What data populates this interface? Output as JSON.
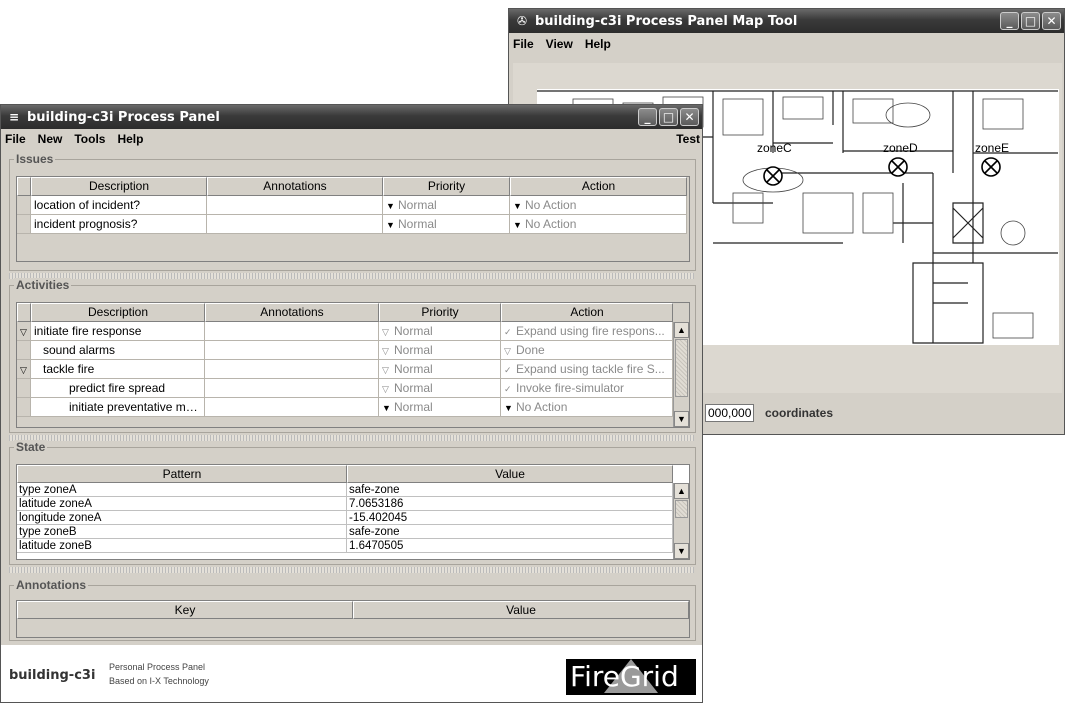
{
  "map_window": {
    "title": "building-c3i Process Panel Map Tool",
    "menu": [
      "File",
      "View",
      "Help"
    ],
    "zones": [
      "zoneC",
      "zoneD",
      "zoneE"
    ],
    "coord_value": "000,000",
    "coord_label": "coordinates"
  },
  "panel_window": {
    "title": "building-c3i Process Panel",
    "menu": [
      "File",
      "New",
      "Tools",
      "Help"
    ],
    "menu_right": "Test",
    "issues": {
      "label": "Issues",
      "columns": [
        "Description",
        "Annotations",
        "Priority",
        "Action"
      ],
      "rows": [
        {
          "description": "location of incident?",
          "annotations": "",
          "priority": "Normal",
          "action": "No Action"
        },
        {
          "description": "incident prognosis?",
          "annotations": "",
          "priority": "Normal",
          "action": "No Action"
        }
      ]
    },
    "activities": {
      "label": "Activities",
      "columns": [
        "Description",
        "Annotations",
        "Priority",
        "Action"
      ],
      "rows": [
        {
          "description": "initiate fire response",
          "priority": "Normal",
          "action": "Expand using fire respons..."
        },
        {
          "description": "sound alarms",
          "priority": "Normal",
          "action": "Done"
        },
        {
          "description": "tackle fire",
          "priority": "Normal",
          "action": "Expand using tackle fire S..."
        },
        {
          "description": "predict fire spread",
          "priority": "Normal",
          "action": "Invoke fire-simulator"
        },
        {
          "description": "initiate preventative mea...",
          "priority": "Normal",
          "action": "No Action"
        }
      ]
    },
    "state": {
      "label": "State",
      "columns": [
        "Pattern",
        "Value"
      ],
      "rows": [
        {
          "pattern": "type zoneA",
          "value": "safe-zone"
        },
        {
          "pattern": "latitude zoneA",
          "value": "7.0653186"
        },
        {
          "pattern": "longitude zoneA",
          "value": "-15.402045"
        },
        {
          "pattern": "type zoneB",
          "value": "safe-zone"
        },
        {
          "pattern": "latitude zoneB",
          "value": "1.6470505"
        }
      ]
    },
    "annotations": {
      "label": "Annotations",
      "columns": [
        "Key",
        "Value"
      ]
    },
    "footer": {
      "app_name": "building-c3i",
      "line1": "Personal Process Panel",
      "line2": "Based on I-X Technology",
      "logo_text": "FireGrid"
    }
  },
  "colors": {
    "titlebar": "#3a3a3a",
    "window_bg": "#d4d0c8",
    "logo_bg": "#000000"
  }
}
